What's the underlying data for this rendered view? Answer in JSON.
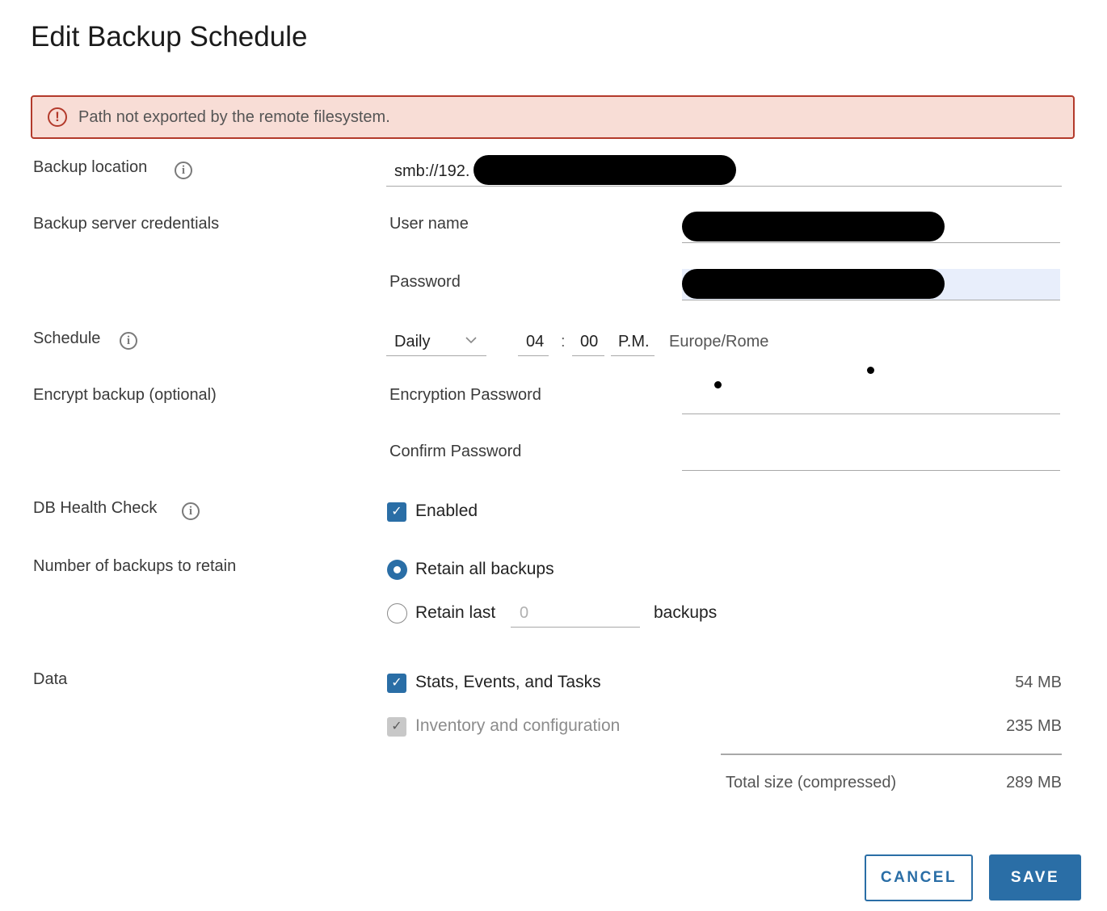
{
  "dialog": {
    "title": "Edit Backup Schedule"
  },
  "alert": {
    "message": "Path not exported by the remote filesystem.",
    "icon": "error-icon",
    "color": "#b33a2b"
  },
  "backup_location": {
    "label": "Backup location",
    "value": "smb://192."
  },
  "credentials": {
    "label": "Backup server credentials",
    "username_label": "User name",
    "password_label": "Password"
  },
  "schedule": {
    "label": "Schedule",
    "frequency": "Daily",
    "hour": "04",
    "separator": ":",
    "minute": "00",
    "ampm": "P.M.",
    "timezone": "Europe/Rome"
  },
  "encrypt": {
    "label": "Encrypt backup (optional)",
    "password_label": "Encryption Password",
    "confirm_label": "Confirm Password"
  },
  "health_check": {
    "label": "DB Health Check",
    "option_label": "Enabled",
    "checked": true
  },
  "retention": {
    "label": "Number of backups to retain",
    "retain_all_label": "Retain all backups",
    "retain_last_label": "Retain last",
    "retain_last_placeholder": "0",
    "retain_last_suffix": "backups",
    "selected": "retain_all"
  },
  "data": {
    "label": "Data",
    "items": [
      {
        "label": "Stats, Events, and Tasks",
        "size": "54 MB",
        "checked": true,
        "disabled": false
      },
      {
        "label": "Inventory and configuration",
        "size": "235 MB",
        "checked": true,
        "disabled": true
      }
    ],
    "total_label": "Total size (compressed)",
    "total_size": "289 MB"
  },
  "buttons": {
    "cancel": "CANCEL",
    "save": "SAVE"
  },
  "colors": {
    "primary": "#2a6ea6",
    "alert_bg": "#f8ddd6",
    "alert_border": "#b33a2b"
  }
}
